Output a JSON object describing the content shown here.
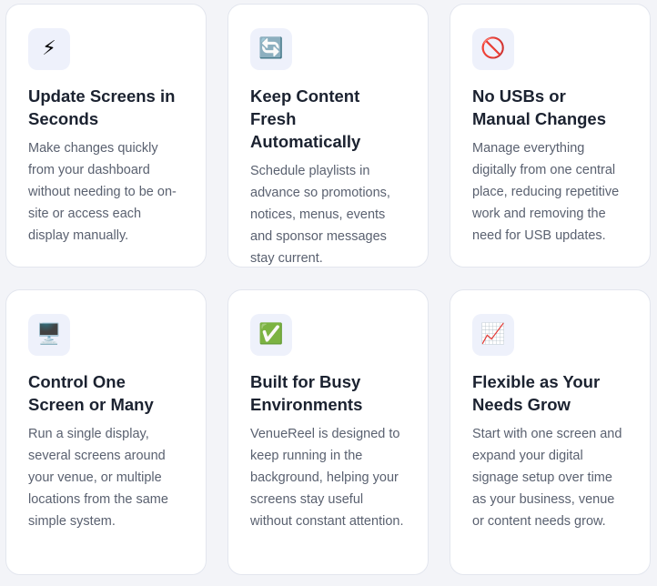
{
  "cards": [
    {
      "icon": "⚡",
      "icon_name": "lightning-icon",
      "title": "Update Screens in Seconds",
      "description": "Make changes quickly from your dashboard without needing to be on-site or access each display manually."
    },
    {
      "icon": "🔄",
      "icon_name": "refresh-icon",
      "title": "Keep Content Fresh Automatically",
      "description": "Schedule playlists in advance so promotions, notices, menus, events and sponsor messages stay current."
    },
    {
      "icon": "🚫",
      "icon_name": "prohibited-icon",
      "title": "No USBs or Manual Changes",
      "description": "Manage everything digitally from one central place, reducing repetitive work and removing the need for USB updates."
    },
    {
      "icon": "🖥️",
      "icon_name": "desktop-monitor-icon",
      "title": "Control One Screen or Many",
      "description": "Run a single display, several screens around your venue, or multiple locations from the same simple system."
    },
    {
      "icon": "✅",
      "icon_name": "check-mark-icon",
      "title": "Built for Busy Environments",
      "description": "VenueReel is designed to keep running in the background, helping your screens stay useful without constant attention."
    },
    {
      "icon": "📈",
      "icon_name": "chart-increasing-icon",
      "title": "Flexible as Your Needs Grow",
      "description": "Start with one screen and expand your digital signage setup over time as your business, venue or content needs grow."
    }
  ],
  "colors": {
    "background": "#f3f4f8",
    "card": "#ffffff",
    "icon_bg": "#eef1fb",
    "title": "#1b2230",
    "text": "#5a6170"
  }
}
